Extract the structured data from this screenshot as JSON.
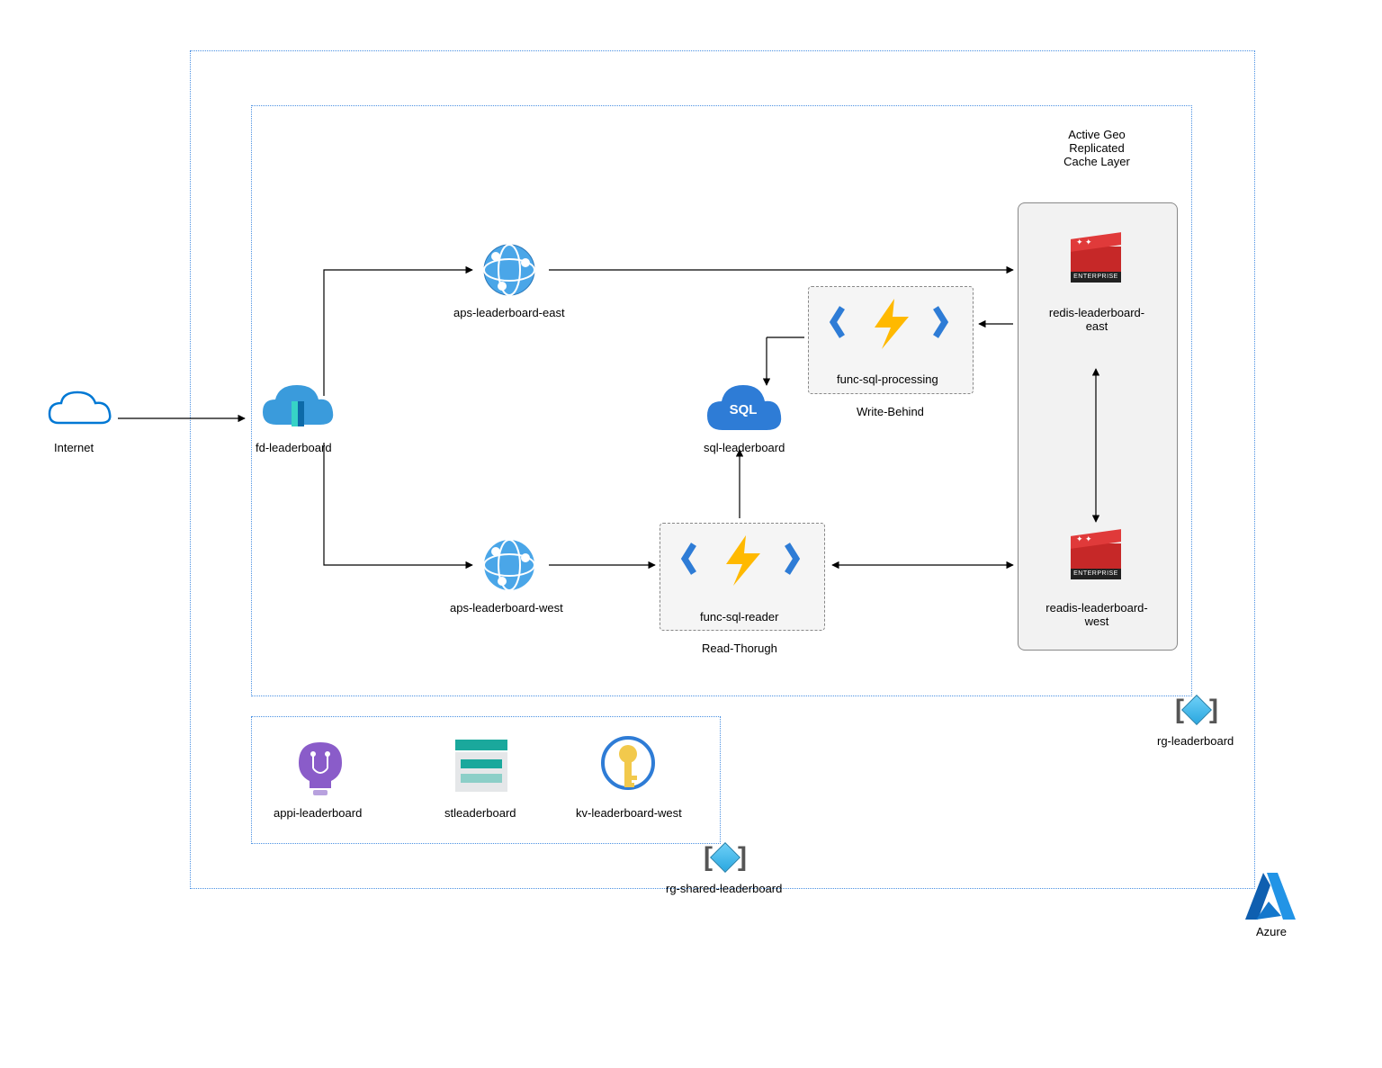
{
  "labels": {
    "internet": "Internet",
    "fd": "fd-leaderboard",
    "aps_east": "aps-leaderboard-east",
    "aps_west": "aps-leaderboard-west",
    "sql": "sql-leaderboard",
    "func_processing": "func-sql-processing",
    "func_reader": "func-sql-reader",
    "write_behind": "Write-Behind",
    "read_through": "Read-Thorugh",
    "redis_east": "redis-leaderboard-east",
    "redis_west": "readis-leaderboard-west",
    "cache_title1": "Active  Geo",
    "cache_title2": "Replicated",
    "cache_title3": "Cache Layer",
    "appi": "appi-leaderboard",
    "storage": "stleaderboard",
    "kv": "kv-leaderboard-west",
    "rg_leaderboard": "rg-leaderboard",
    "rg_shared": "rg-shared-leaderboard",
    "azure": "Azure",
    "enterprise": "ENTERPRISE"
  },
  "colors": {
    "azure_blue": "#0078d4",
    "light_blue": "#3a9bdc",
    "func_yellow": "#ffb900",
    "func_blue": "#2e7cd6",
    "sql_blue": "#1f6fd0",
    "redis_red": "#c62828",
    "purple": "#8a5cc9",
    "teal": "#1aa89c",
    "key_yellow": "#f2c94c"
  }
}
